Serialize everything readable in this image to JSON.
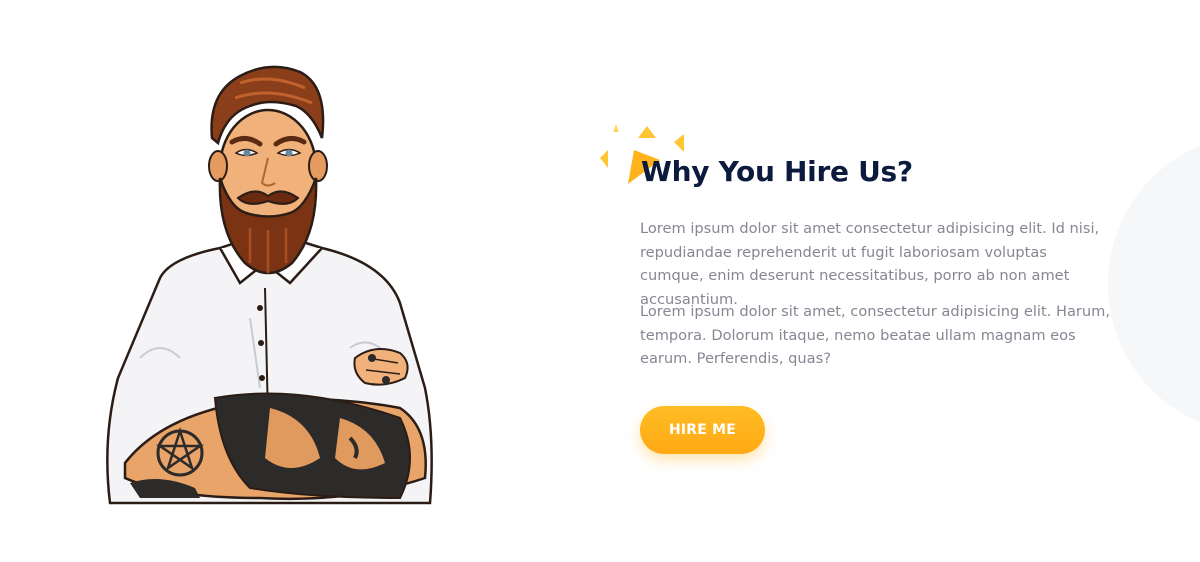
{
  "hero": {
    "illustration": "bearded-tattooed-man-illustration",
    "title": "Why You Hire Us?",
    "paragraphs": [
      "Lorem ipsum dolor sit amet consectetur adipisicing elit. Id nisi, repudiandae reprehenderit ut fugit laboriosam voluptas cumque, enim deserunt necessitatibus, porro ab non amet accusantium.",
      "Lorem ipsum dolor sit amet, consectetur adipisicing elit. Harum, tempora. Dolorum itaque, nemo beatae ullam magnam eos earum. Perferendis, quas?"
    ],
    "cta_label": "HIRE ME"
  },
  "colors": {
    "title": "#0c1a3d",
    "text": "#858792",
    "accent": "#ffb31a",
    "bg_circle": "#f6f7f9"
  }
}
